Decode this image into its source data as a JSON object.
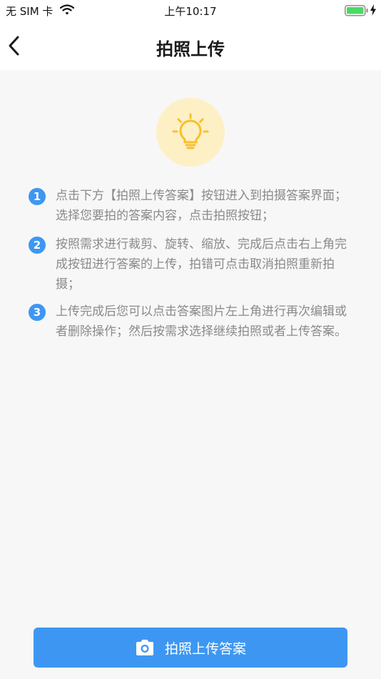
{
  "status_bar": {
    "carrier": "无 SIM 卡",
    "time": "上午10:17",
    "battery_level": 1.0,
    "battery_color": "#4cd964"
  },
  "nav": {
    "title": "拍照上传",
    "back_icon": "chevron-left-icon"
  },
  "hero": {
    "icon": "lightbulb-icon",
    "bg_color": "#fdf0c5",
    "icon_color": "#f7c02d"
  },
  "steps": [
    {
      "num": "1",
      "text": "点击下方【拍照上传答案】按钮进入到拍摄答案界面；选择您要拍的答案内容，点击拍照按钮；"
    },
    {
      "num": "2",
      "text": "按照需求进行裁剪、旋转、缩放、完成后点击右上角完成按钮进行答案的上传，拍错可点击取消拍照重新拍摄；"
    },
    {
      "num": "3",
      "text": "上传完成后您可以点击答案图片左上角进行再次编辑或者删除操作；然后按需求选择继续拍照或者上传答案。"
    }
  ],
  "upload_button": {
    "label": "拍照上传答案",
    "icon": "camera-icon",
    "color": "#3d97f2"
  }
}
